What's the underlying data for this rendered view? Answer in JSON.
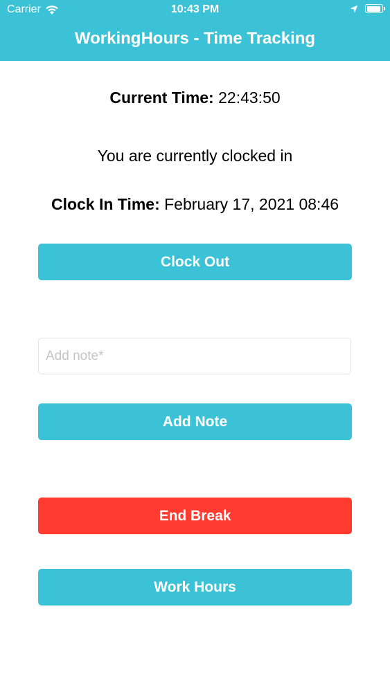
{
  "status_bar": {
    "carrier": "Carrier",
    "time": "10:43 PM",
    "icons": [
      "wifi-icon",
      "location-arrow-icon",
      "battery-icon"
    ]
  },
  "header": {
    "title": "WorkingHours - Time Tracking",
    "color": "#3bc2d6"
  },
  "current_time": {
    "label": "Current Time:",
    "value": "22:43:50"
  },
  "clock_status": "You are currently clocked in",
  "clock_in": {
    "label": "Clock In Time:",
    "value": "February 17, 2021 08:46"
  },
  "buttons": {
    "clock_out": "Clock Out",
    "add_note": "Add Note",
    "end_break": "End Break",
    "work_hours": "Work Hours"
  },
  "note_input": {
    "placeholder": "Add note*",
    "value": ""
  },
  "colors": {
    "primary": "#3bc2d6",
    "danger": "#ff3b30"
  }
}
